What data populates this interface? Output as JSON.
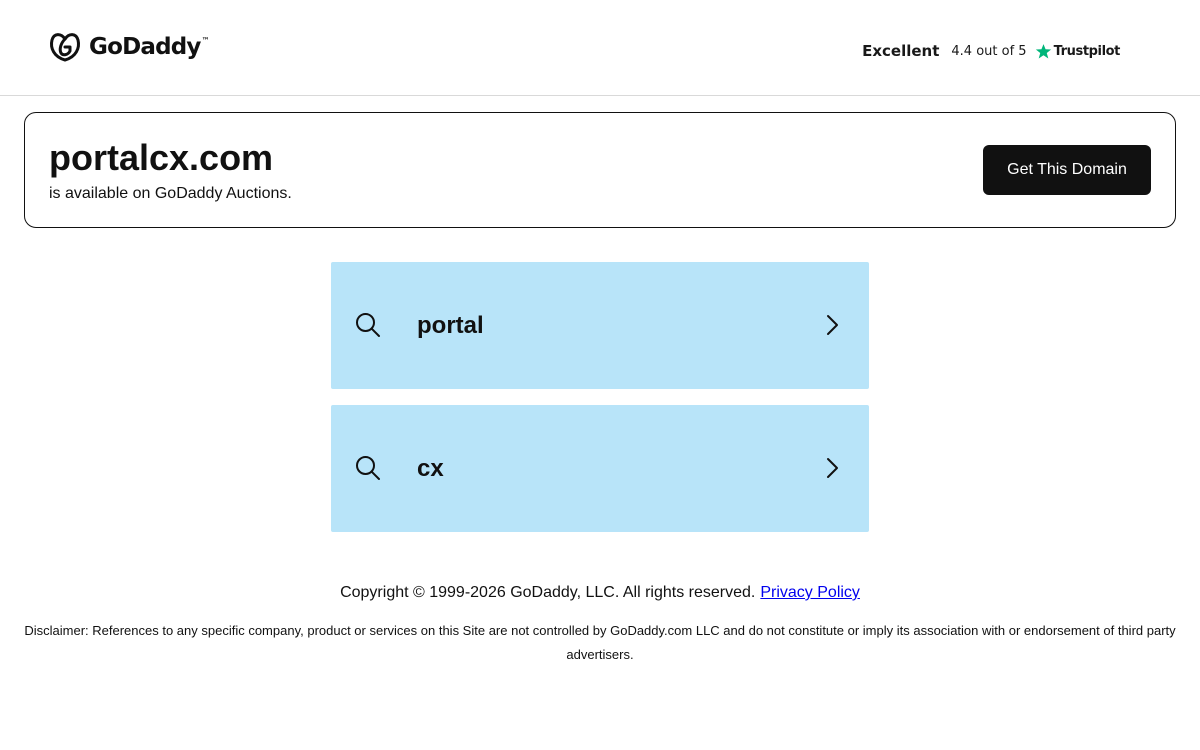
{
  "header": {
    "logo_text": "GoDaddy",
    "logo_tm": "™",
    "trustpilot": {
      "excellent": "Excellent",
      "rating": "4.4 out of 5",
      "brand": "Trustpilot",
      "star_color": "#00b67a"
    }
  },
  "domain": {
    "name": "portalcx.com",
    "availability": "is available on GoDaddy Auctions.",
    "cta_label": "Get This Domain"
  },
  "search_suggestions": [
    {
      "label": "portal"
    },
    {
      "label": "cx"
    }
  ],
  "footer": {
    "copyright": "Copyright © 1999-2026 GoDaddy, LLC. All rights reserved.",
    "privacy_link": "Privacy Policy",
    "disclaimer": "Disclaimer: References to any specific company, product or services on this Site are not controlled by GoDaddy.com LLC and do not constitute or imply its association with or endorsement of third party advertisers."
  },
  "colors": {
    "tile_background": "#b8e4f9",
    "button_background": "#111111",
    "link": "#0000ee"
  },
  "icons": {
    "logo": "godaddy-logo-icon",
    "star": "trustpilot-star-icon",
    "search": "search-icon",
    "chevron": "chevron-right-icon"
  }
}
